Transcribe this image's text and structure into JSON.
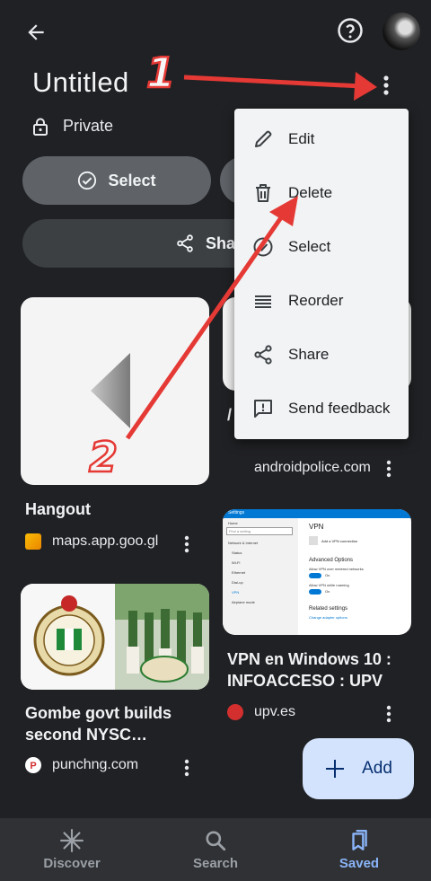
{
  "header": {
    "title": "Untitled",
    "privacy_label": "Private"
  },
  "actions": {
    "select_label": "Select",
    "share_label": "Sha"
  },
  "cards": [
    {
      "title": "Hangout",
      "source": "maps.app.goo.gl"
    },
    {
      "title": "/ A",
      "source": "androidpolice.com"
    },
    {
      "title": "VPN en Windows 10 : INFOACCESO : UPV",
      "source": "upv.es"
    },
    {
      "title": "Gombe govt builds second NYSC…",
      "source": "punchng.com"
    }
  ],
  "vpn_thumb": {
    "header": "Settings",
    "search_placeholder": "Find a setting",
    "heading": "VPN",
    "add_vpn": "Add a VPN connection",
    "advanced": "Advanced Options",
    "metered": "Allow VPN over metered networks",
    "roaming": "Allow VPN while roaming",
    "on": "On",
    "related": "Related settings",
    "adapter": "Change adapter options",
    "sidebar": [
      "Home",
      "Network & Internet",
      "Status",
      "Wi-Fi",
      "Ethernet",
      "Dial-up",
      "VPN",
      "Airplane mode"
    ]
  },
  "fab": {
    "label": "Add"
  },
  "menu": {
    "items": [
      {
        "label": "Edit",
        "icon": "pencil-icon"
      },
      {
        "label": "Delete",
        "icon": "trash-icon"
      },
      {
        "label": "Select",
        "icon": "check-circle-icon"
      },
      {
        "label": "Reorder",
        "icon": "reorder-icon"
      },
      {
        "label": "Share",
        "icon": "share-icon"
      },
      {
        "label": "Send feedback",
        "icon": "feedback-icon"
      }
    ]
  },
  "bottom_nav": {
    "items": [
      {
        "label": "Discover",
        "icon": "asterisk-icon"
      },
      {
        "label": "Search",
        "icon": "search-icon"
      },
      {
        "label": "Saved",
        "icon": "bookmarks-icon"
      }
    ]
  },
  "annotations": {
    "step1": "1",
    "step2": "2"
  },
  "colors": {
    "background": "#202124",
    "menu": "#f1f3f4",
    "accent": "#8ab4f8",
    "fab": "#d3e3fd",
    "annotation": "#e53935"
  }
}
